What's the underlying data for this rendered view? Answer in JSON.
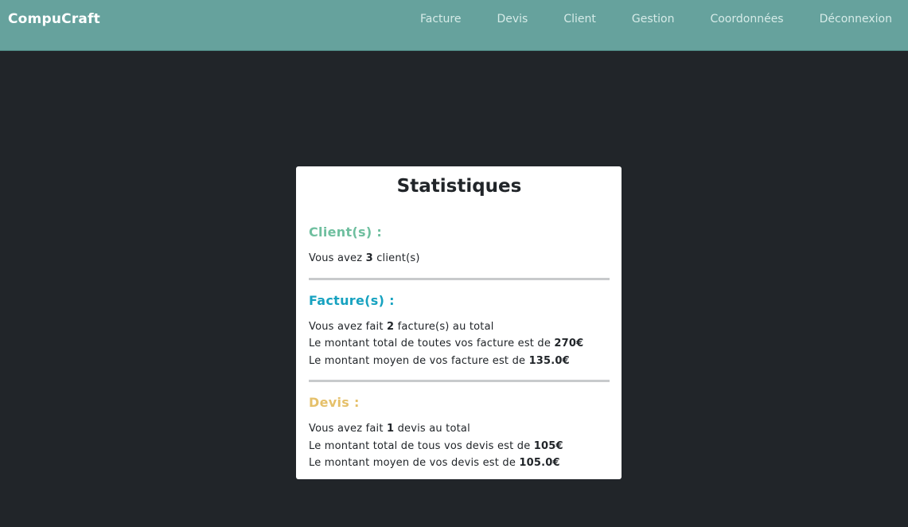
{
  "navbar": {
    "brand": "CompuCraft",
    "links": [
      "Facture",
      "Devis",
      "Client",
      "Gestion",
      "Coordonnées",
      "Déconnexion"
    ]
  },
  "card": {
    "title": "Statistiques",
    "clients": {
      "heading": "Client(s) :",
      "l1_pre": "Vous avez ",
      "count": "3",
      "l1_post": " client(s)"
    },
    "factures": {
      "heading": "Facture(s) :",
      "l1_pre": "Vous avez fait ",
      "count": "2",
      "l1_post": " facture(s) au total",
      "l2_pre": "Le montant total de toutes vos facture est de ",
      "total": "270€",
      "l3_pre": "Le montant moyen de vos facture est de ",
      "average": "135.0€"
    },
    "devis": {
      "heading": "Devis :",
      "l1_pre": "Vous avez fait ",
      "count": "1",
      "l1_post": " devis au total",
      "l2_pre": "Le montant total de tous vos devis est de ",
      "total": "105€",
      "l3_pre": "Le montant moyen de vos devis est de ",
      "average": "105.0€"
    }
  },
  "colors": {
    "navbar": "#66a29d",
    "background": "#212529",
    "clients": "#6fbf9f",
    "factures": "#17a2c0",
    "devis": "#e5c06a"
  }
}
